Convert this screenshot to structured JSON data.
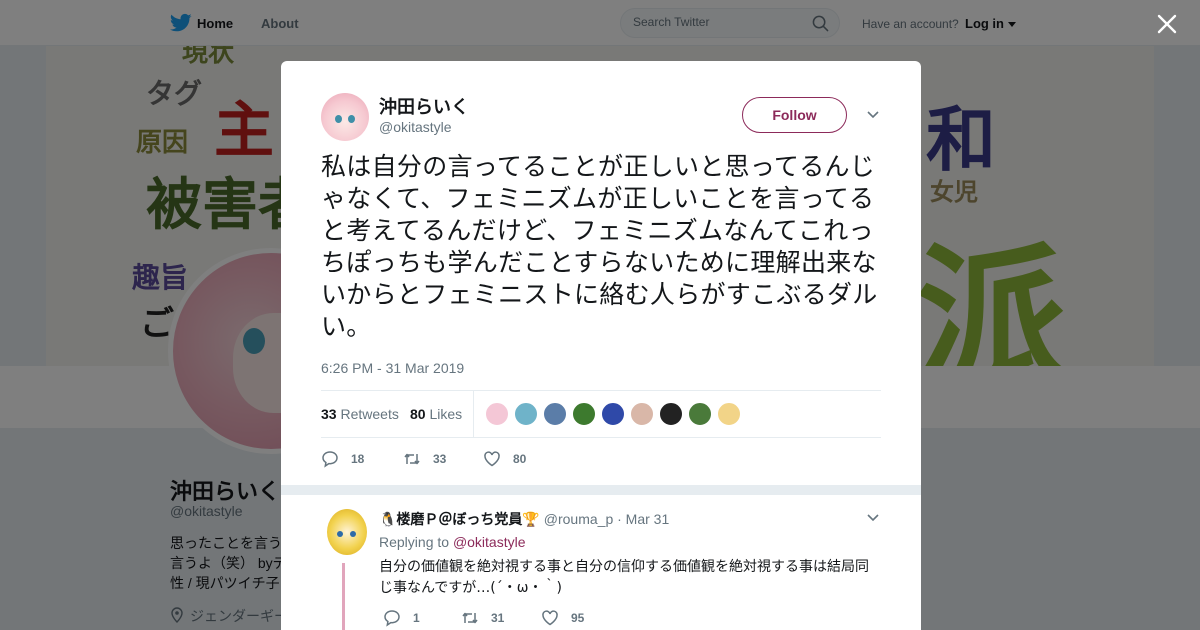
{
  "nav": {
    "home": "Home",
    "about": "About",
    "search_placeholder": "Search Twitter",
    "have_account": "Have an account?",
    "login": "Log in"
  },
  "background_profile": {
    "banner_words": [
      "現状",
      "タグ",
      "主",
      "原因",
      "被害者",
      "趣旨",
      "ご",
      "和",
      "女児",
      "派"
    ],
    "name": "沖田らいく",
    "handle": "@okitastyle",
    "bio_line1": "思ったことを言う",
    "bio_line2": "言うよ（笑） byデ",
    "bio_line3": "性 / 現パツイチ子",
    "location": "ジェンダーギー"
  },
  "tweet": {
    "name": "沖田らいく",
    "handle": "@okitastyle",
    "follow_label": "Follow",
    "text": "私は自分の言ってることが正しいと思ってるんじゃなくて、フェミニズムが正しいことを言ってると考えてるんだけど、フェミニズムなんてこれっちぽっちも学んだことすらないために理解出来ないからとフェミニストに絡む人らがすこぶるダルい。",
    "timestamp": "6:26 PM - 31 Mar 2019",
    "retweets_count": "33",
    "retweets_label": "Retweets",
    "likes_count": "80",
    "likes_label": "Likes",
    "reply_count": "18",
    "retweet_count": "33",
    "like_count": "80"
  },
  "reply": {
    "name": "🐧楼磨Ｐ＠ぼっち党員🏆",
    "handle": "@rouma_p",
    "date": "· Mar 31",
    "replying_prefix": "Replying to",
    "replying_to": "@okitastyle",
    "text": "自分の価値観を絶対視する事と自分の信仰する価値観を絶対視する事は結局同じ事なんですが…(´・ω・｀)",
    "reply_count": "1",
    "retweet_count": "31",
    "like_count": "95"
  },
  "colors": {
    "accent": "#8c2a5a",
    "twitter_blue": "#1da1f2",
    "muted": "#66757f",
    "liker_avatars": [
      "#f4c7d6",
      "#6fb3c9",
      "#5b7da8",
      "#3d7a2e",
      "#2f49a8",
      "#d9b7a8",
      "#222222",
      "#4a7a3a",
      "#f2d488"
    ]
  }
}
